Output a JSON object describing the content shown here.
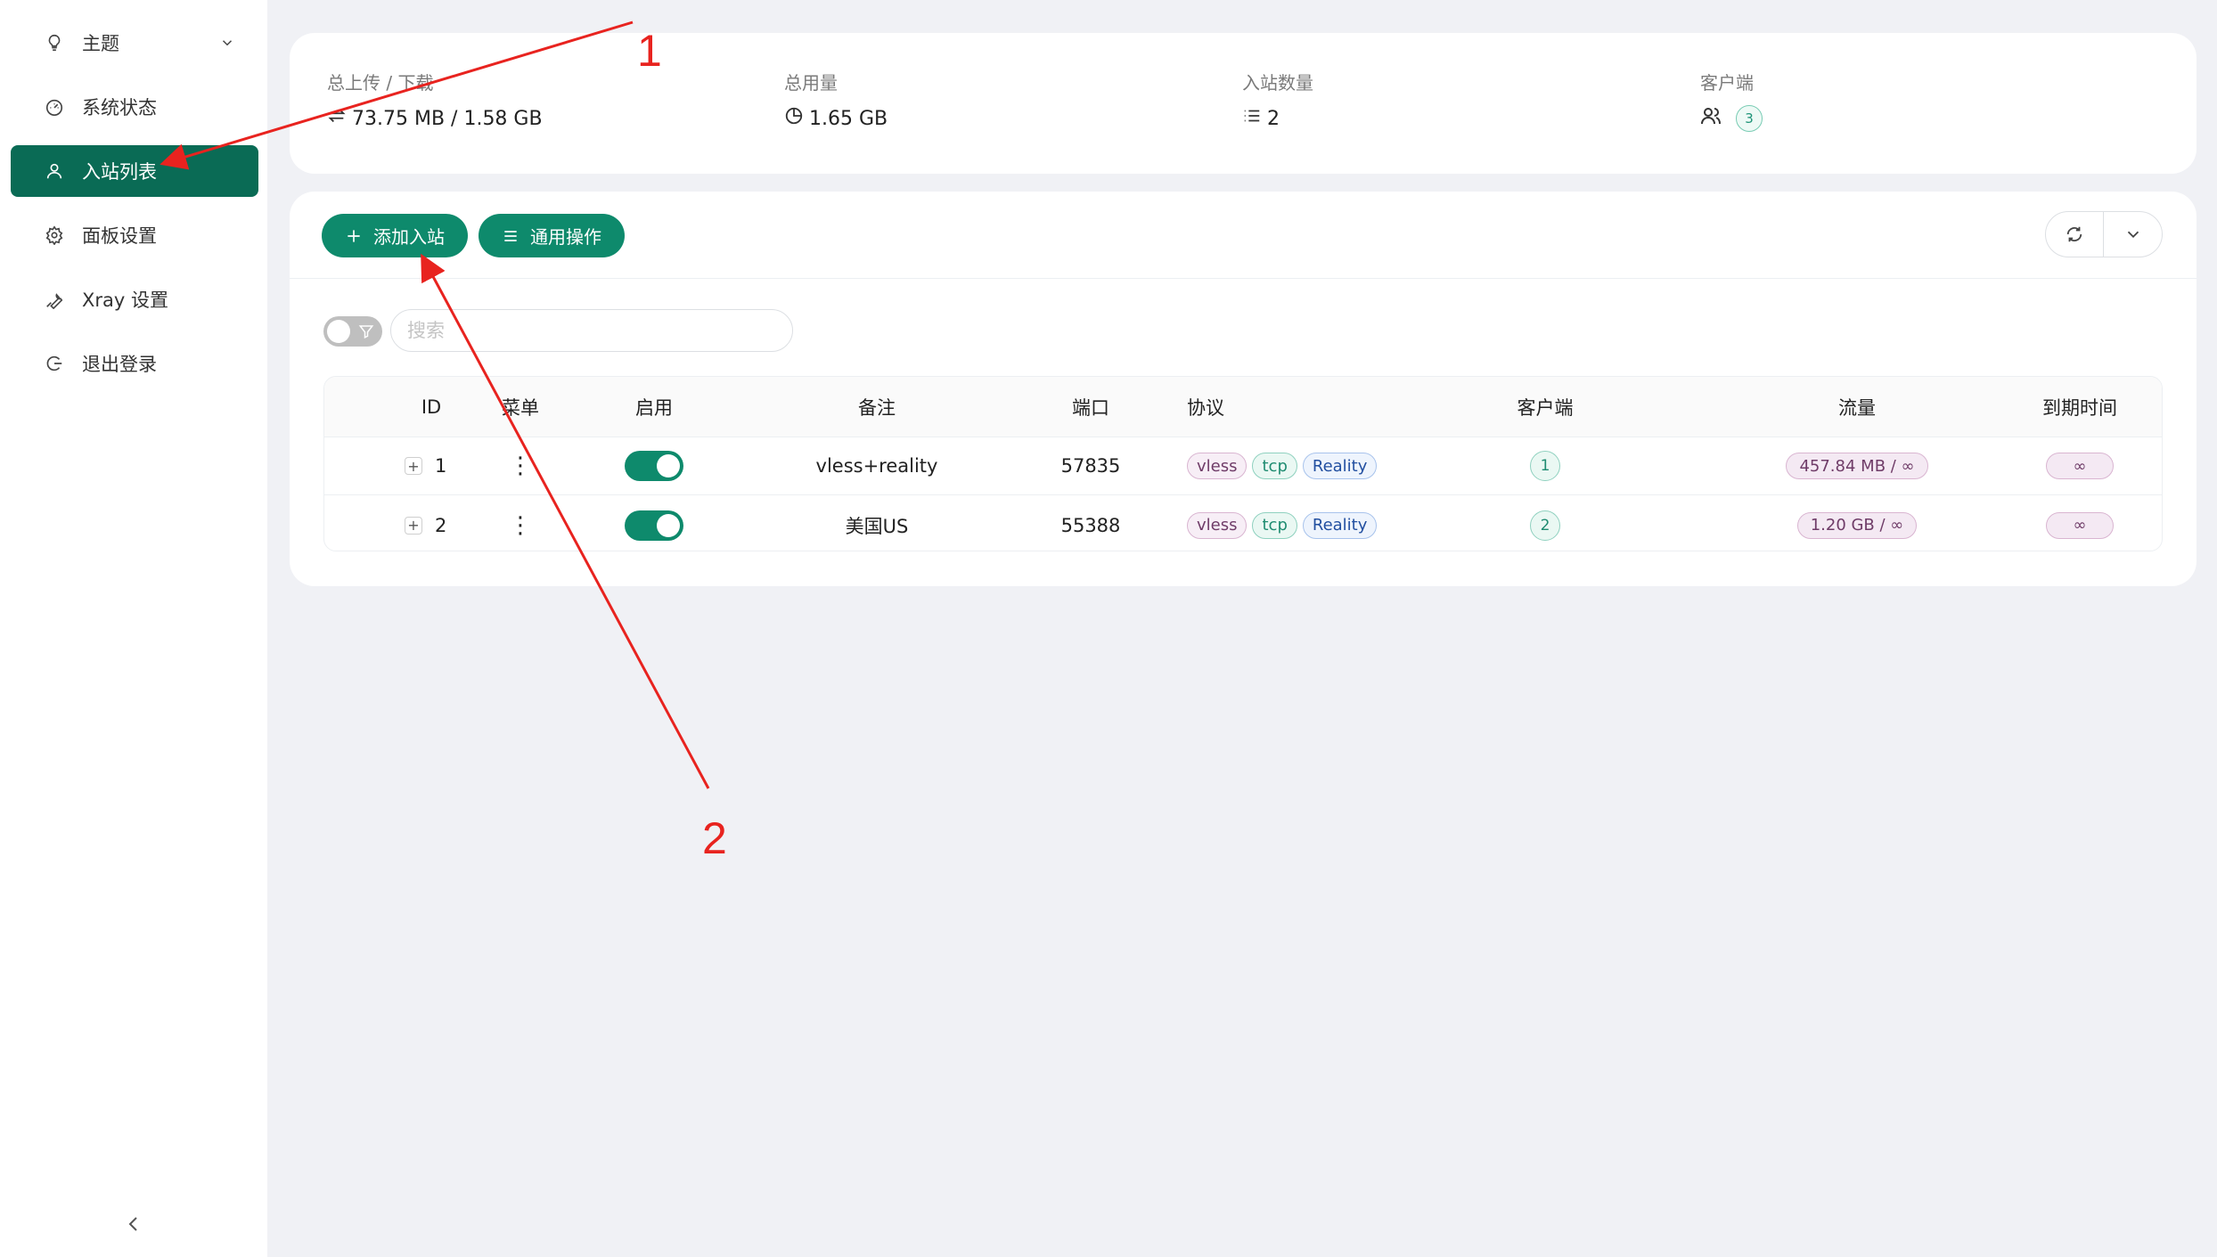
{
  "sidebar": {
    "items": [
      {
        "label": "主题",
        "icon": "bulb-icon"
      },
      {
        "label": "系统状态",
        "icon": "dashboard-icon"
      },
      {
        "label": "入站列表",
        "icon": "user-icon"
      },
      {
        "label": "面板设置",
        "icon": "gear-icon"
      },
      {
        "label": "Xray 设置",
        "icon": "tool-icon"
      },
      {
        "label": "退出登录",
        "icon": "logout-icon"
      }
    ],
    "active_index": 2
  },
  "stats": {
    "upload_download": {
      "label": "总上传 / 下载",
      "value": "73.75 MB / 1.58 GB"
    },
    "total_usage": {
      "label": "总用量",
      "value": "1.65 GB"
    },
    "inbound_count": {
      "label": "入站数量",
      "value": "2"
    },
    "clients": {
      "label": "客户端",
      "value": "3"
    }
  },
  "toolbar": {
    "add_inbound": "添加入站",
    "general_actions": "通用操作"
  },
  "search": {
    "placeholder": "搜索"
  },
  "table": {
    "headers": {
      "id": "ID",
      "menu": "菜单",
      "enable": "启用",
      "remark": "备注",
      "port": "端口",
      "protocol": "协议",
      "clients": "客户端",
      "traffic": "流量",
      "expiry": "到期时间"
    },
    "rows": [
      {
        "id": "1",
        "menu": "⋮",
        "enabled": true,
        "remark": "vless+reality",
        "port": "57835",
        "protocol": "vless",
        "network": "tcp",
        "security": "Reality",
        "clients": "1",
        "traffic": "457.84 MB / ∞",
        "expiry": "∞"
      },
      {
        "id": "2",
        "menu": "⋮",
        "enabled": true,
        "remark": "美国US",
        "port": "55388",
        "protocol": "vless",
        "network": "tcp",
        "security": "Reality",
        "clients": "2",
        "traffic": "1.20 GB / ∞",
        "expiry": "∞"
      }
    ]
  },
  "annotations": {
    "label_1": "1",
    "label_2": "2",
    "color": "#e8231f"
  },
  "colors": {
    "accent": "#0e8a6c",
    "active_menu": "#0a6b55",
    "background": "#f0f1f5"
  }
}
